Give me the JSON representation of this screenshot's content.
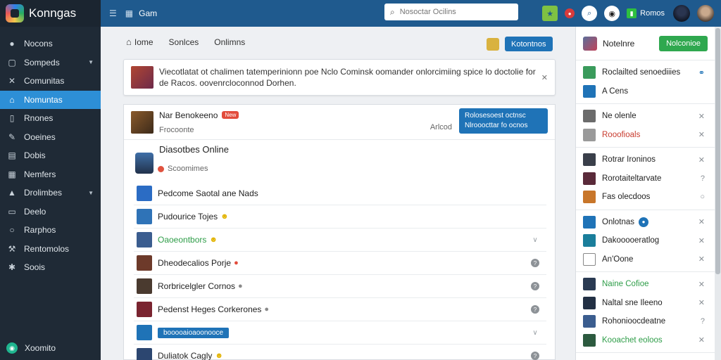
{
  "app": {
    "name": "Konngas"
  },
  "sidebar": {
    "items": [
      {
        "label": "Nocons",
        "icon": "info-icon",
        "glyph": "●"
      },
      {
        "label": "Sompeds",
        "icon": "square-icon",
        "glyph": "▢",
        "caret": true
      },
      {
        "label": "Comunitas",
        "icon": "tools-icon",
        "glyph": "✕"
      },
      {
        "label": "Nomuntas",
        "icon": "home-icon",
        "glyph": "⌂",
        "active": true
      },
      {
        "label": "Rnones",
        "icon": "page-icon",
        "glyph": "▯"
      },
      {
        "label": "Ooeines",
        "icon": "pencil-icon",
        "glyph": "✎"
      },
      {
        "label": "Dobis",
        "icon": "doc-icon",
        "glyph": "▤"
      },
      {
        "label": "Nemfers",
        "icon": "grid-icon",
        "glyph": "▦"
      },
      {
        "label": "Drolimbes",
        "icon": "building-icon",
        "glyph": "▲",
        "caret": true
      },
      {
        "label": "Deelo",
        "icon": "file-icon",
        "glyph": "▭"
      },
      {
        "label": "Rarphos",
        "icon": "circle-icon",
        "glyph": "○"
      },
      {
        "label": "Rentomolos",
        "icon": "wrench-icon",
        "glyph": "⚒"
      },
      {
        "label": "Soois",
        "icon": "gear-icon",
        "glyph": "✱"
      }
    ],
    "footer": {
      "label": "Xoomito",
      "icon": "chat-icon",
      "glyph": "◉"
    }
  },
  "topbar": {
    "title": "Gam",
    "search_placeholder": "Nosoctar Ocilins",
    "status_label": "Romos",
    "colors": {
      "bar": "#1f5a8e"
    }
  },
  "main": {
    "tabs": [
      "Iome",
      "Sonlces",
      "Onlimns"
    ],
    "top_button": "Kotontnos",
    "notice": {
      "text": "Viecotlatat ot chalimen tatemperinionn poe Nclo Cominsk oomander onlorcimiing spice lo doctolie for de Racos. oovenrcloconnod Dorhen."
    },
    "card": {
      "name": "Nar Benokeeno",
      "tag": "New",
      "sub": "Frocoonte",
      "author": "Arlcod",
      "cta": "Rolosesoest octnsc Nlrooocttar fo ocnos",
      "section_title": "Diasotbes Online",
      "section_status": "Scoomimes",
      "rows": [
        {
          "label": "Pedcome Saotal ane Nads",
          "icon_color": "#2b6cc4",
          "emoji": "",
          "end": ""
        },
        {
          "label": "Pudourice Tojes",
          "icon_color": "#2f73b7",
          "emoji": "☻",
          "end": ""
        },
        {
          "label": "Oaoeontbors",
          "icon_color": "#3b5d8f",
          "emoji": "☻",
          "end": "chev",
          "green": true
        },
        {
          "label": "Dheodecalios Porje",
          "icon_color": "#6d3a2a",
          "emoji": "●",
          "emoji_class": "red",
          "end": "dot"
        },
        {
          "label": "Rorbricelgler Cornos",
          "icon_color": "#4a3a2f",
          "emoji": "●",
          "emoji_class": "grey",
          "end": "dot"
        },
        {
          "label": "Pedenst Heges Corkerones",
          "icon_color": "#7a2430",
          "emoji": "●",
          "emoji_class": "grey",
          "end": "dot"
        },
        {
          "label": "",
          "pill": "booooaioaoonooce",
          "icon_color": "#1f73b7",
          "emoji": "",
          "end": "chev"
        },
        {
          "label": "Duliatok Cagly",
          "icon_color": "#2c4670",
          "emoji": "☻",
          "end": "dot"
        }
      ]
    }
  },
  "rpanel": {
    "head": {
      "label": "Notelnre",
      "button": "Nolconioe"
    },
    "groups": [
      [
        {
          "label": "Roclailted senoediiies",
          "color": "#3a9b5c",
          "end": "link"
        },
        {
          "label": "A Cens",
          "color": "#1f73b7",
          "end": ""
        }
      ],
      [
        {
          "label": "Ne olenle",
          "color": "#6b6b6b",
          "end": "x"
        },
        {
          "label": "Rooofioals",
          "color": "#9a9a9a",
          "end": "x",
          "red": true
        }
      ],
      [
        {
          "label": "Rotrar Ironinos",
          "color": "#3a3f4a",
          "end": "x"
        },
        {
          "label": "Rorotaiteltarvate",
          "color": "#5a2a3a",
          "end": "?"
        },
        {
          "label": "Fas olecdoos",
          "color": "#c8762a",
          "end": "o"
        }
      ],
      [
        {
          "label": "Onlotnas",
          "color": "#1f73b7",
          "end": "x",
          "badge": "●"
        },
        {
          "label": "Dakooooeratlog",
          "color": "#1a7e9b",
          "end": "x"
        },
        {
          "label": "An'Oone",
          "color": "#ffffff",
          "end": "x"
        }
      ],
      [
        {
          "label": "Naine Cofioe",
          "color": "#2a3a52",
          "end": "x",
          "green": true
        },
        {
          "label": "Naltal sne Ileeno",
          "color": "#223044",
          "end": "x"
        },
        {
          "label": "Rohonioocdeatne",
          "color": "#3b5d8f",
          "end": "?"
        },
        {
          "label": "Kooachet eoloos",
          "color": "#2c5a3f",
          "end": "x",
          "green": true
        }
      ]
    ]
  }
}
